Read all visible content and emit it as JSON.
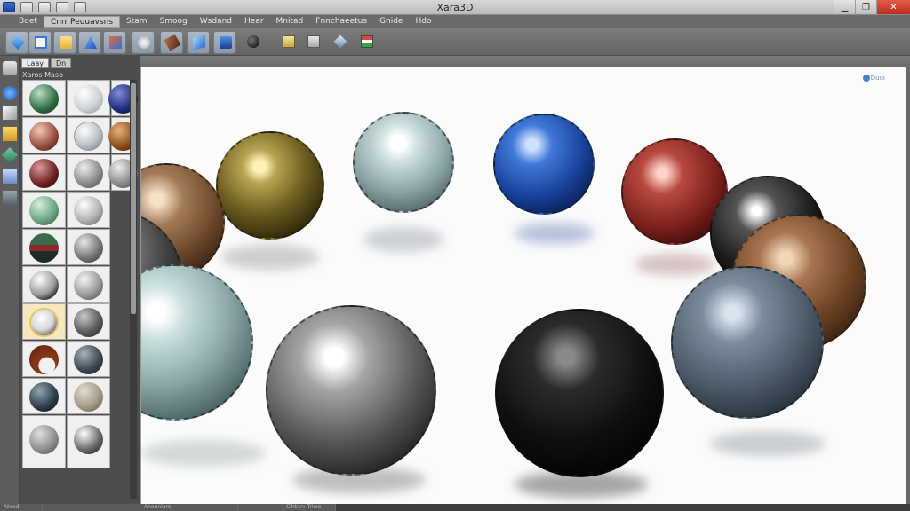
{
  "window": {
    "title": "Xara3D"
  },
  "menu": {
    "items": [
      "Bdet",
      "Cnrr Peuuavsns",
      "Stam",
      "Smoog",
      "Wsdand",
      "Hear",
      "Mnitad",
      "Fnnchaeetus",
      "Gnide",
      "Hdo"
    ],
    "active_index": 1
  },
  "gallery": {
    "tabs": [
      "Laay",
      "Dn"
    ],
    "label": "Xaros Maso"
  },
  "canvas": {
    "zoom_label": "Duui"
  },
  "statusbar": {
    "items": [
      "Ahrxd",
      "Ahonnlaro",
      "Clhtarv Triwo"
    ]
  },
  "colors": {
    "accent": "#3a6fd0",
    "canvas": "#fbfbfb",
    "chrome": "#6a6a6a"
  }
}
